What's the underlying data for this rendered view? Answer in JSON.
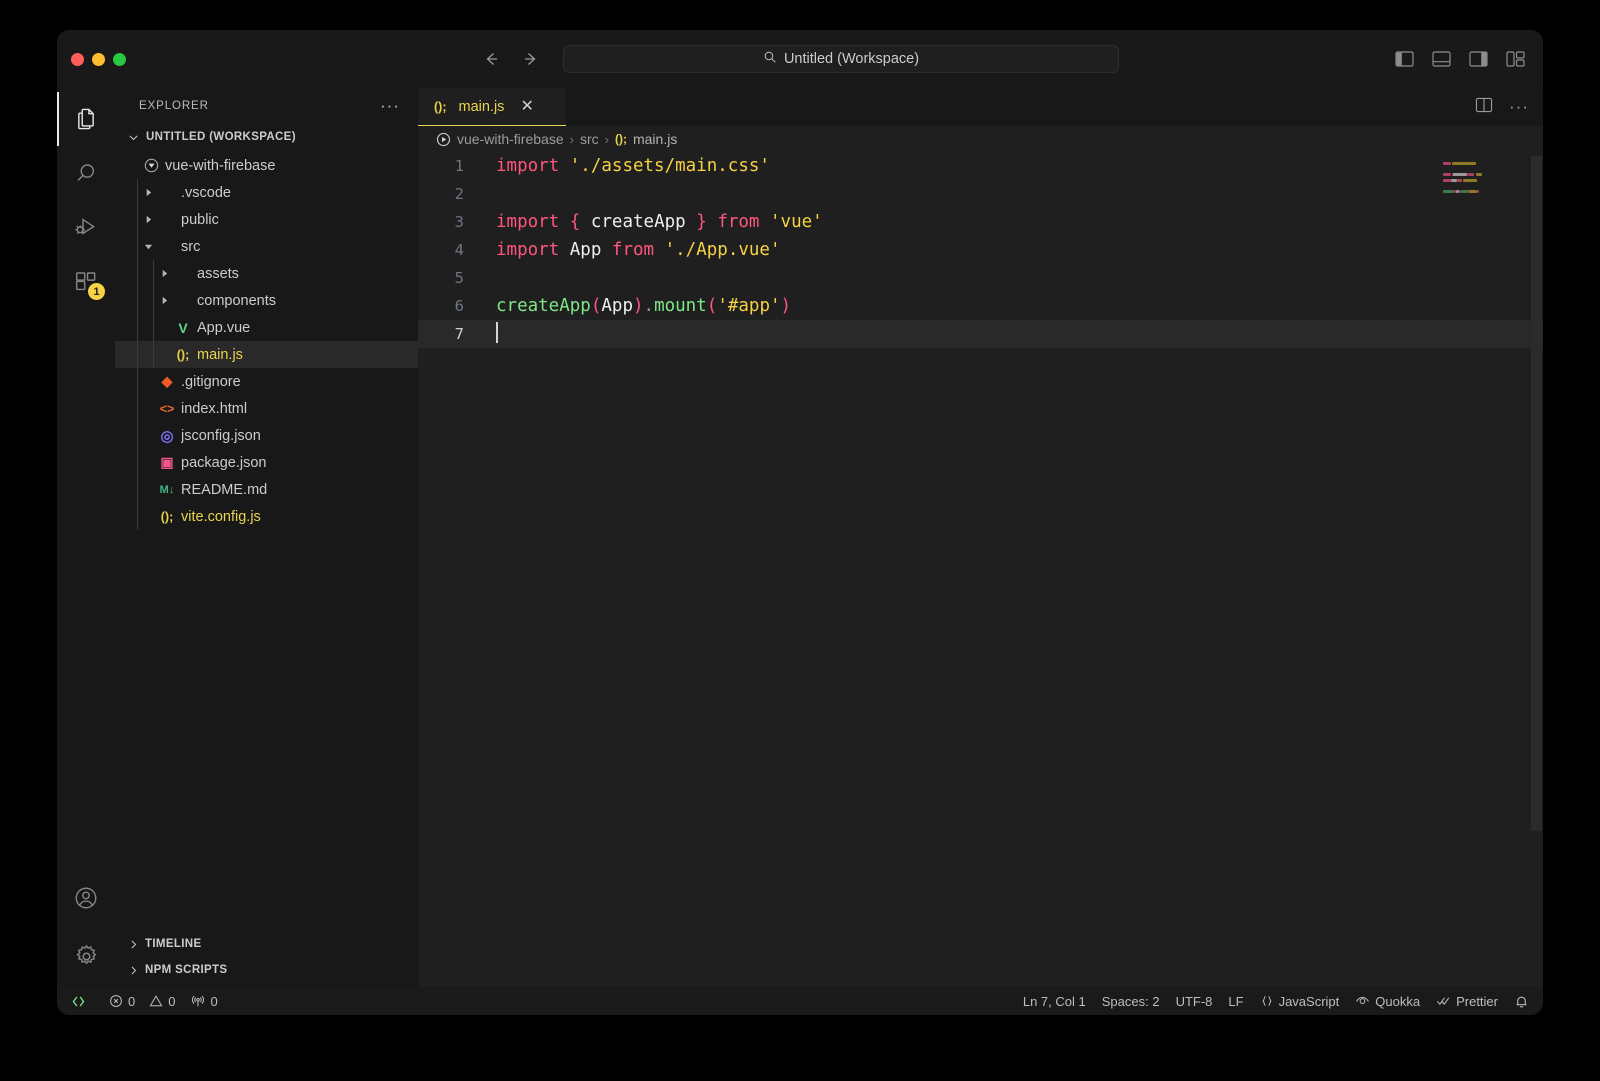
{
  "window": {
    "traffic_lights": [
      {
        "name": "close",
        "color": "#ff5f57"
      },
      {
        "name": "minimize",
        "color": "#febc2e"
      },
      {
        "name": "maximize",
        "color": "#28c840"
      }
    ]
  },
  "titlebar": {
    "back_label": "Go Back",
    "forward_label": "Go Forward",
    "command_center_text": "Untitled (Workspace)",
    "search_icon": "search-icon",
    "layout_buttons": [
      {
        "name": "toggle-primary-sidebar",
        "label": "Toggle Primary Side Bar"
      },
      {
        "name": "toggle-panel",
        "label": "Toggle Panel"
      },
      {
        "name": "toggle-secondary-sidebar",
        "label": "Toggle Secondary Side Bar"
      },
      {
        "name": "customize-layout",
        "label": "Customize Layout..."
      }
    ]
  },
  "activitybar": {
    "items": [
      {
        "name": "explorer",
        "icon": "files-icon",
        "label": "Explorer",
        "active": true,
        "badge": null
      },
      {
        "name": "search",
        "icon": "search-icon",
        "label": "Search",
        "active": false,
        "badge": null
      },
      {
        "name": "run-and-debug",
        "icon": "debug-icon",
        "label": "Run and Debug",
        "active": false,
        "badge": null
      },
      {
        "name": "extensions",
        "icon": "extensions-icon",
        "label": "Extensions",
        "active": false,
        "badge": "1"
      }
    ],
    "bottom_items": [
      {
        "name": "accounts",
        "icon": "account-icon",
        "label": "Accounts"
      },
      {
        "name": "manage",
        "icon": "gear-icon",
        "label": "Manage"
      }
    ]
  },
  "sidebar": {
    "title": "EXPLORER",
    "more_actions": "···",
    "workspace_section": "UNTITLED (WORKSPACE)",
    "tree": [
      {
        "label": "vue-with-firebase",
        "indent": 0,
        "kind": "root-folder",
        "expanded": true,
        "icon": "vue-folder-icon",
        "icon_glyph": "▼",
        "icon_color": "#a0a0a0",
        "selected": false
      },
      {
        "label": ".vscode",
        "indent": 1,
        "kind": "folder",
        "expanded": false,
        "icon": "folder-icon",
        "icon_glyph": "",
        "icon_color": "#a0a0a0",
        "selected": false
      },
      {
        "label": "public",
        "indent": 1,
        "kind": "folder",
        "expanded": false,
        "icon": "folder-icon",
        "icon_glyph": "",
        "icon_color": "#a0a0a0",
        "selected": false
      },
      {
        "label": "src",
        "indent": 1,
        "kind": "folder",
        "expanded": true,
        "icon": "folder-icon",
        "icon_glyph": "",
        "icon_color": "#a0a0a0",
        "selected": false
      },
      {
        "label": "assets",
        "indent": 2,
        "kind": "folder",
        "expanded": false,
        "icon": "folder-icon",
        "icon_glyph": "",
        "icon_color": "#a0a0a0",
        "selected": false
      },
      {
        "label": "components",
        "indent": 2,
        "kind": "folder",
        "expanded": false,
        "icon": "folder-icon",
        "icon_glyph": "",
        "icon_color": "#a0a0a0",
        "selected": false
      },
      {
        "label": "App.vue",
        "indent": 2,
        "kind": "file",
        "expanded": false,
        "icon": "vue-file-icon",
        "icon_glyph": "V",
        "icon_color": "#61d48a",
        "selected": false
      },
      {
        "label": "main.js",
        "indent": 2,
        "kind": "file",
        "expanded": false,
        "icon": "javascript-file-icon",
        "icon_glyph": "();",
        "icon_color": "#e8d44d",
        "selected": true
      },
      {
        "label": ".gitignore",
        "indent": 1,
        "kind": "file",
        "expanded": false,
        "icon": "git-file-icon",
        "icon_glyph": "◆",
        "icon_color": "#f05a28",
        "selected": false
      },
      {
        "label": "index.html",
        "indent": 1,
        "kind": "file",
        "expanded": false,
        "icon": "html-file-icon",
        "icon_glyph": "<>",
        "icon_color": "#f06529",
        "selected": false
      },
      {
        "label": "jsconfig.json",
        "indent": 1,
        "kind": "file",
        "expanded": false,
        "icon": "json-file-icon",
        "icon_glyph": "◎",
        "icon_color": "#7c6df2",
        "selected": false
      },
      {
        "label": "package.json",
        "indent": 1,
        "kind": "file",
        "expanded": false,
        "icon": "npm-file-icon",
        "icon_glyph": "▣",
        "icon_color": "#f1568f",
        "selected": false
      },
      {
        "label": "README.md",
        "indent": 1,
        "kind": "file",
        "expanded": false,
        "icon": "markdown-file-icon",
        "icon_glyph": "M↓",
        "icon_color": "#42b883",
        "selected": false
      },
      {
        "label": "vite.config.js",
        "indent": 1,
        "kind": "file",
        "expanded": false,
        "icon": "javascript-file-icon",
        "icon_glyph": "();",
        "icon_color": "#e8d44d",
        "selected": false
      }
    ],
    "collapsed_sections": [
      {
        "label": "TIMELINE",
        "name": "timeline"
      },
      {
        "label": "NPM SCRIPTS",
        "name": "npm-scripts"
      }
    ]
  },
  "editor": {
    "tabs": [
      {
        "label": "main.js",
        "icon_glyph": "();",
        "icon_color": "#e8d44d",
        "active": true,
        "close_glyph": "✕"
      }
    ],
    "actions": [
      {
        "name": "split-editor-right",
        "label": "Split Editor Right"
      },
      {
        "name": "more-actions",
        "label": "More Actions..."
      }
    ],
    "breadcrumbs": [
      {
        "label": "vue-with-firebase",
        "icon": null
      },
      {
        "label": "src",
        "icon": null
      },
      {
        "label": "main.js",
        "icon": "javascript-file-icon",
        "icon_glyph": "();"
      }
    ],
    "breadcrumb_separator": "›",
    "run_icon": "run-play-icon",
    "active_line": 7,
    "lines": [
      {
        "number": "1",
        "tokens": [
          {
            "text": "import",
            "cls": "t-kw"
          },
          {
            "text": " ",
            "cls": "t-var"
          },
          {
            "text": "'./assets/main.css'",
            "cls": "t-str"
          }
        ]
      },
      {
        "number": "2",
        "tokens": []
      },
      {
        "number": "3",
        "tokens": [
          {
            "text": "import",
            "cls": "t-kw"
          },
          {
            "text": " ",
            "cls": "t-var"
          },
          {
            "text": "{",
            "cls": "t-pun"
          },
          {
            "text": " createApp ",
            "cls": "t-var"
          },
          {
            "text": "}",
            "cls": "t-pun"
          },
          {
            "text": " ",
            "cls": "t-var"
          },
          {
            "text": "from",
            "cls": "t-kw"
          },
          {
            "text": " ",
            "cls": "t-var"
          },
          {
            "text": "'vue'",
            "cls": "t-str"
          }
        ]
      },
      {
        "number": "4",
        "tokens": [
          {
            "text": "import",
            "cls": "t-kw"
          },
          {
            "text": " App ",
            "cls": "t-var"
          },
          {
            "text": "from",
            "cls": "t-kw"
          },
          {
            "text": " ",
            "cls": "t-var"
          },
          {
            "text": "'./App.vue'",
            "cls": "t-str"
          }
        ]
      },
      {
        "number": "5",
        "tokens": []
      },
      {
        "number": "6",
        "tokens": [
          {
            "text": "createApp",
            "cls": "t-fn"
          },
          {
            "text": "(",
            "cls": "t-pun"
          },
          {
            "text": "App",
            "cls": "t-var"
          },
          {
            "text": ")",
            "cls": "t-pun"
          },
          {
            "text": ".",
            "cls": "t-dot"
          },
          {
            "text": "mount",
            "cls": "t-fn"
          },
          {
            "text": "(",
            "cls": "t-pun"
          },
          {
            "text": "'#app'",
            "cls": "t-str"
          },
          {
            "text": ")",
            "cls": "t-pun"
          }
        ]
      },
      {
        "number": "7",
        "tokens": [],
        "cursor": true
      }
    ]
  },
  "statusbar": {
    "left": [
      {
        "name": "remote-host",
        "icon": "remote-icon",
        "label": "",
        "color": "#7ee787"
      },
      {
        "name": "problems-errors",
        "icon": "error-circle-icon",
        "label": "0"
      },
      {
        "name": "problems-warnings",
        "icon": "warning-triangle-icon",
        "label": "0"
      },
      {
        "name": "ports",
        "icon": "radio-tower-icon",
        "label": "0"
      }
    ],
    "right": [
      {
        "name": "editor-position",
        "icon": null,
        "label": "Ln 7, Col 1"
      },
      {
        "name": "editor-indentation",
        "icon": null,
        "label": "Spaces: 2"
      },
      {
        "name": "editor-encoding",
        "icon": null,
        "label": "UTF-8"
      },
      {
        "name": "editor-eol",
        "icon": null,
        "label": "LF"
      },
      {
        "name": "editor-language",
        "icon": "braces-icon",
        "label": "JavaScript"
      },
      {
        "name": "quokka",
        "icon": "eye-icon",
        "label": "Quokka"
      },
      {
        "name": "prettier",
        "icon": "checkmarks-icon",
        "label": "Prettier"
      },
      {
        "name": "notifications",
        "icon": "bell-icon",
        "label": ""
      }
    ]
  },
  "colors": {
    "accent": "#e8d44d",
    "background": "#1f1f1f",
    "sidebar_bg": "#181818",
    "badge": "#f6d244"
  }
}
